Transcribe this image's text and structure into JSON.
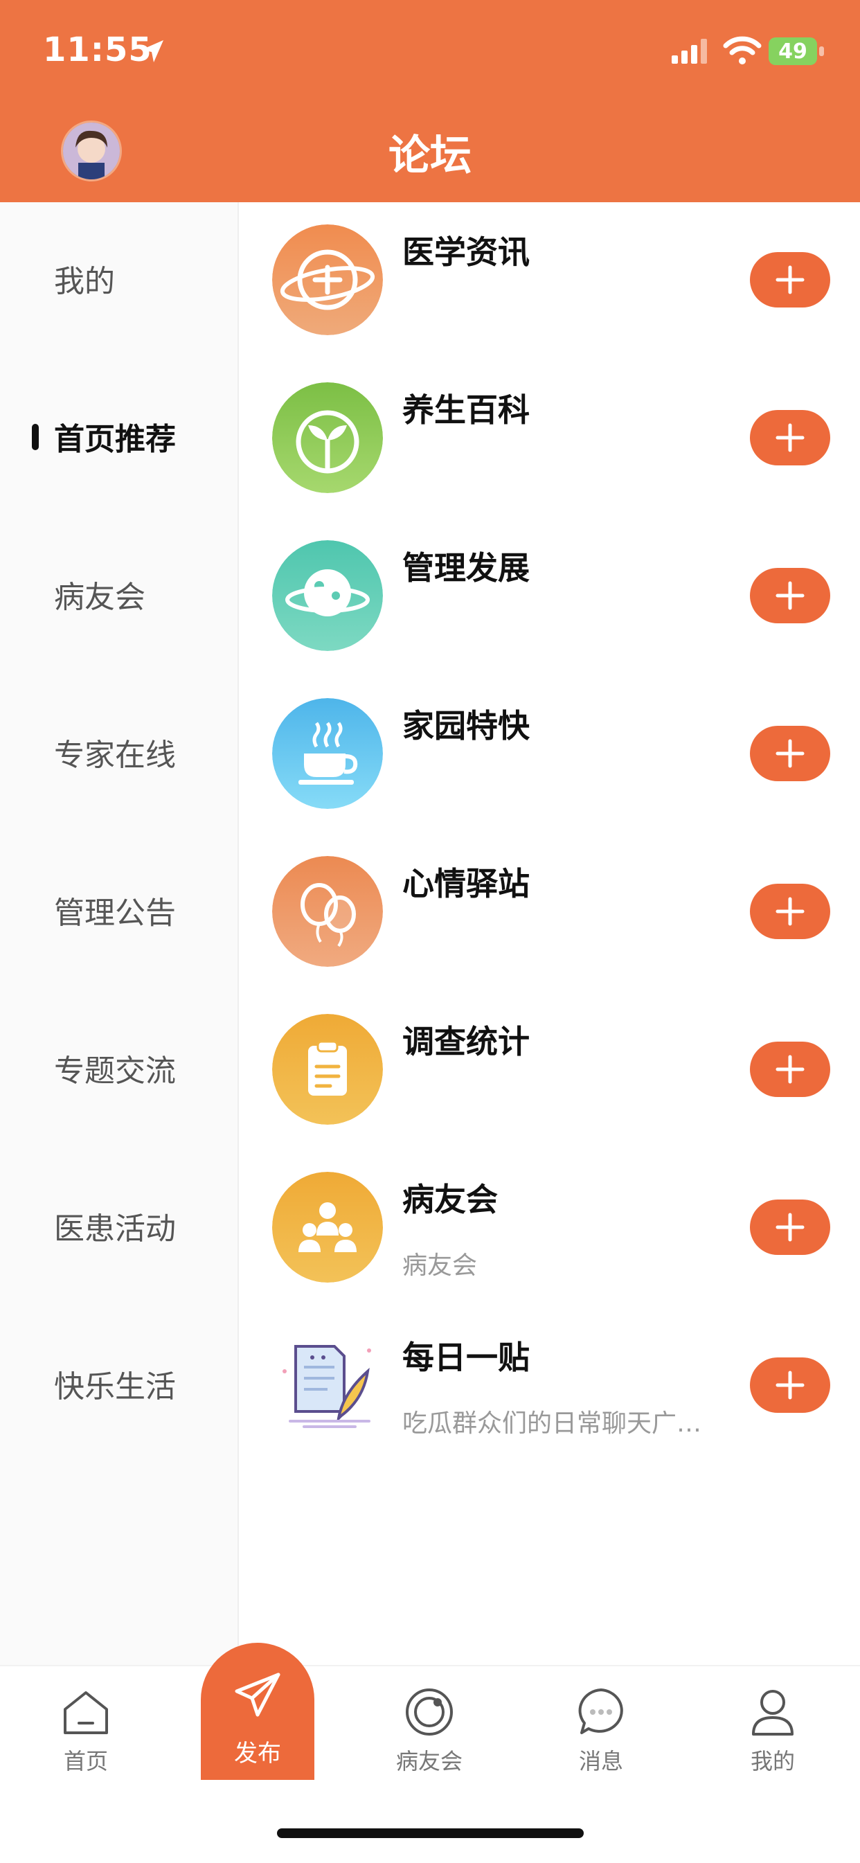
{
  "status_bar": {
    "time": "11:55",
    "battery": "49"
  },
  "header": {
    "title": "论坛"
  },
  "sidebar": {
    "items": [
      {
        "label": "我的",
        "active": false
      },
      {
        "label": "首页推荐",
        "active": true
      },
      {
        "label": "病友会",
        "active": false
      },
      {
        "label": "专家在线",
        "active": false
      },
      {
        "label": "管理公告",
        "active": false
      },
      {
        "label": "专题交流",
        "active": false
      },
      {
        "label": "医患活动",
        "active": false
      },
      {
        "label": "快乐生活",
        "active": false
      }
    ]
  },
  "forums": [
    {
      "name": "医学资讯",
      "desc": "",
      "icon": "medical-planet-icon",
      "color": "#EF9A63"
    },
    {
      "name": "养生百科",
      "desc": "",
      "icon": "sprout-icon",
      "color": "#8CC652"
    },
    {
      "name": "管理发展",
      "desc": "",
      "icon": "planet-icon",
      "color": "#5FCDB3"
    },
    {
      "name": "家园特快",
      "desc": "",
      "icon": "coffee-cup-icon",
      "color": "#5BC0EE"
    },
    {
      "name": "心情驿站",
      "desc": "",
      "icon": "balloons-icon",
      "color": "#EE9460"
    },
    {
      "name": "调查统计",
      "desc": "",
      "icon": "clipboard-icon",
      "color": "#F1B33F"
    },
    {
      "name": "病友会",
      "desc": "病友会",
      "icon": "group-people-icon",
      "color": "#F1B33F"
    },
    {
      "name": "每日一贴",
      "desc": "吃瓜群众们的日常聊天广…",
      "icon": "paper-quill-icon",
      "color": "#ffffff"
    }
  ],
  "tabbar": {
    "items": [
      {
        "label": "首页",
        "icon": "home-icon"
      },
      {
        "label": "发布",
        "icon": "paper-plane-icon"
      },
      {
        "label": "病友会",
        "icon": "ring-icon"
      },
      {
        "label": "消息",
        "icon": "chat-bubble-icon"
      },
      {
        "label": "我的",
        "icon": "person-icon"
      }
    ]
  },
  "colors": {
    "brand": "#ED7443",
    "button": "#ED6A3B"
  }
}
